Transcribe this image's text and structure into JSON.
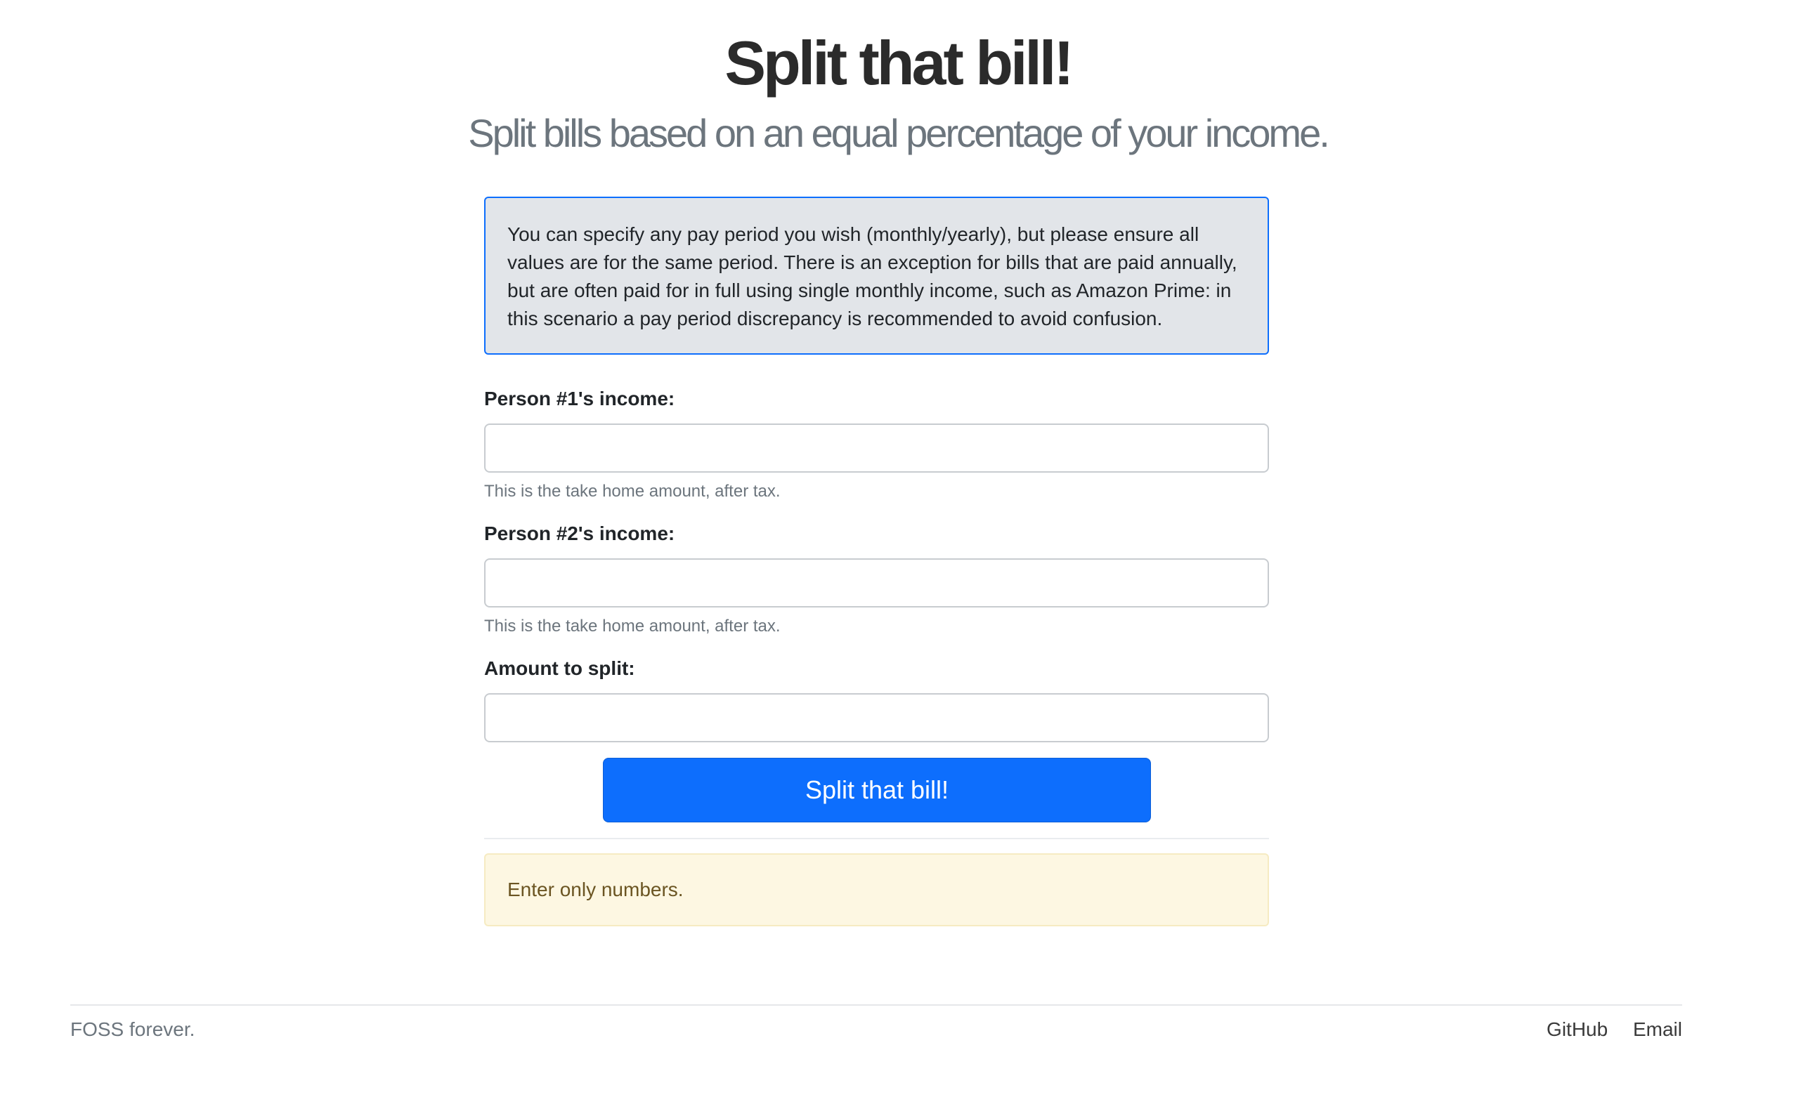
{
  "header": {
    "title": "Split that bill!",
    "subtitle": "Split bills based on an equal percentage of your income."
  },
  "info": {
    "text": "You can specify any pay period you wish (monthly/yearly), but please ensure all values are for the same period. There is an exception for bills that are paid annually, but are often paid for in full using single monthly income, such as Amazon Prime: in this scenario a pay period discrepancy is recommended to avoid confusion."
  },
  "form": {
    "person1": {
      "label": "Person #1's income:",
      "value": "",
      "help": "This is the take home amount, after tax."
    },
    "person2": {
      "label": "Person #2's income:",
      "value": "",
      "help": "This is the take home amount, after tax."
    },
    "amount": {
      "label": "Amount to split:",
      "value": ""
    },
    "submit_label": "Split that bill!"
  },
  "warning": {
    "text": "Enter only numbers."
  },
  "footer": {
    "tagline": "FOSS forever.",
    "links": {
      "github": "GitHub",
      "email": "Email"
    }
  },
  "colors": {
    "primary": "#0d6efd",
    "info_bg": "#e2e5e9",
    "warning_bg": "#fdf7e2",
    "warning_text": "#6b5522"
  }
}
